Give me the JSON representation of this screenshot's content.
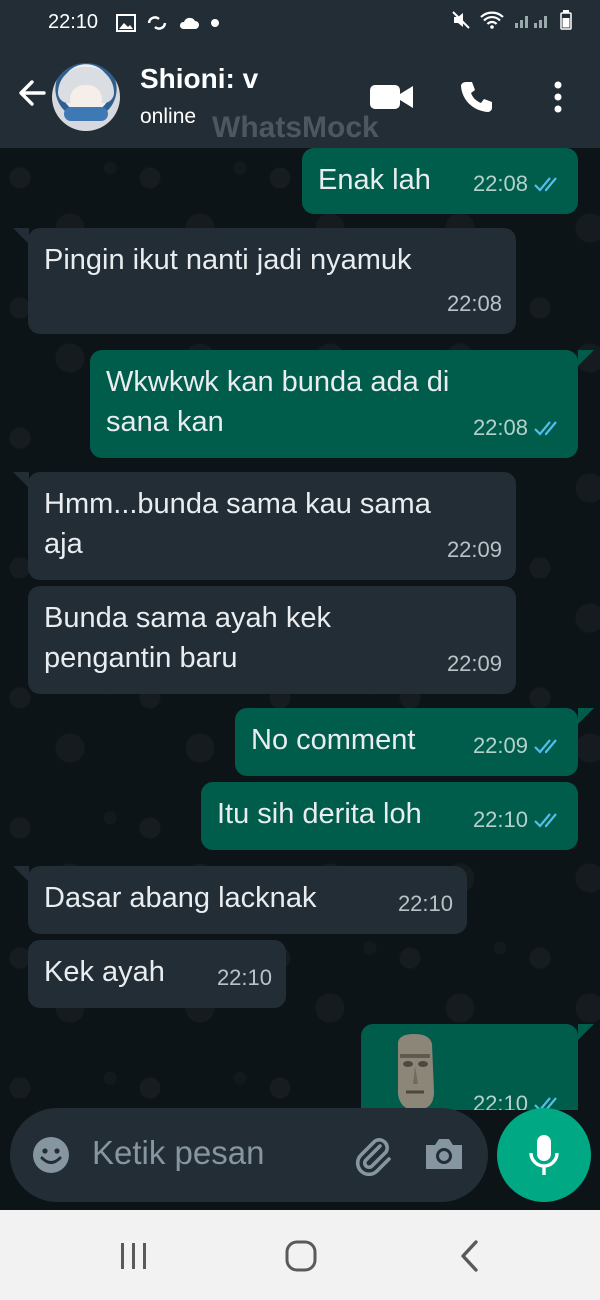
{
  "status_bar": {
    "time": "22:10"
  },
  "header": {
    "contact_name": "Shioni: v",
    "contact_status": "online",
    "watermark": "WhatsMock"
  },
  "messages": [
    {
      "direction": "out",
      "text_lines": [
        "Enak lah"
      ],
      "time": "22:08",
      "read": true
    },
    {
      "direction": "in",
      "text_lines": [
        "Pingin ikut nanti jadi nyamuk"
      ],
      "time": "22:08"
    },
    {
      "direction": "out",
      "text_lines": [
        "Wkwkwk kan bunda ada di",
        "sana kan"
      ],
      "time": "22:08",
      "read": true
    },
    {
      "direction": "in",
      "text_lines": [
        "Hmm...bunda sama kau sama",
        "aja"
      ],
      "time": "22:09"
    },
    {
      "direction": "in",
      "text_lines": [
        "Bunda sama ayah kek",
        "pengantin baru"
      ],
      "time": "22:09"
    },
    {
      "direction": "out",
      "text_lines": [
        "No comment"
      ],
      "time": "22:09",
      "read": true
    },
    {
      "direction": "out",
      "text_lines": [
        "Itu sih derita loh"
      ],
      "time": "22:10",
      "read": true
    },
    {
      "direction": "in",
      "text_lines": [
        "Dasar abang lacknak"
      ],
      "time": "22:10"
    },
    {
      "direction": "in",
      "text_lines": [
        "Kek ayah"
      ],
      "time": "22:10"
    },
    {
      "direction": "out",
      "sticker": "moai-sticker",
      "time": "22:10",
      "read": true
    }
  ],
  "composer": {
    "placeholder": "Ketik pesan"
  },
  "colors": {
    "incoming_bubble": "#232d36",
    "outgoing_bubble": "#005c4b",
    "read_ticks": "#53bdeb",
    "accent": "#00a884"
  },
  "icons": [
    "back-arrow-icon",
    "video-call-icon",
    "voice-call-icon",
    "more-options-icon",
    "emoji-icon",
    "attach-icon",
    "camera-icon",
    "mic-icon"
  ]
}
